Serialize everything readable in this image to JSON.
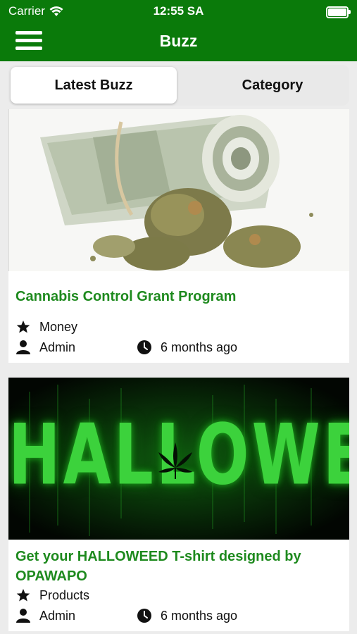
{
  "status_bar": {
    "carrier": "Carrier",
    "time": "12:55 SA"
  },
  "header": {
    "title": "Buzz"
  },
  "tabs": [
    {
      "label": "Latest Buzz",
      "selected": true
    },
    {
      "label": "Category",
      "selected": false
    }
  ],
  "colors": {
    "brand_green": "#0a7a0a",
    "headline_green": "#1e8a1e"
  },
  "posts": [
    {
      "title": "Cannabis Control Grant Program",
      "category": "Money",
      "author": "Admin",
      "time_ago": "6 months ago",
      "image": "rolled-dollar-bills-with-cannabis-buds"
    },
    {
      "title": "Get your HALLOWEED T-shirt designed by OPAWAPO",
      "category": "Products",
      "author": "Admin",
      "time_ago": "6 months ago",
      "image": "halloweed-green-glow-banner",
      "image_text": "HALLOWEED"
    }
  ]
}
